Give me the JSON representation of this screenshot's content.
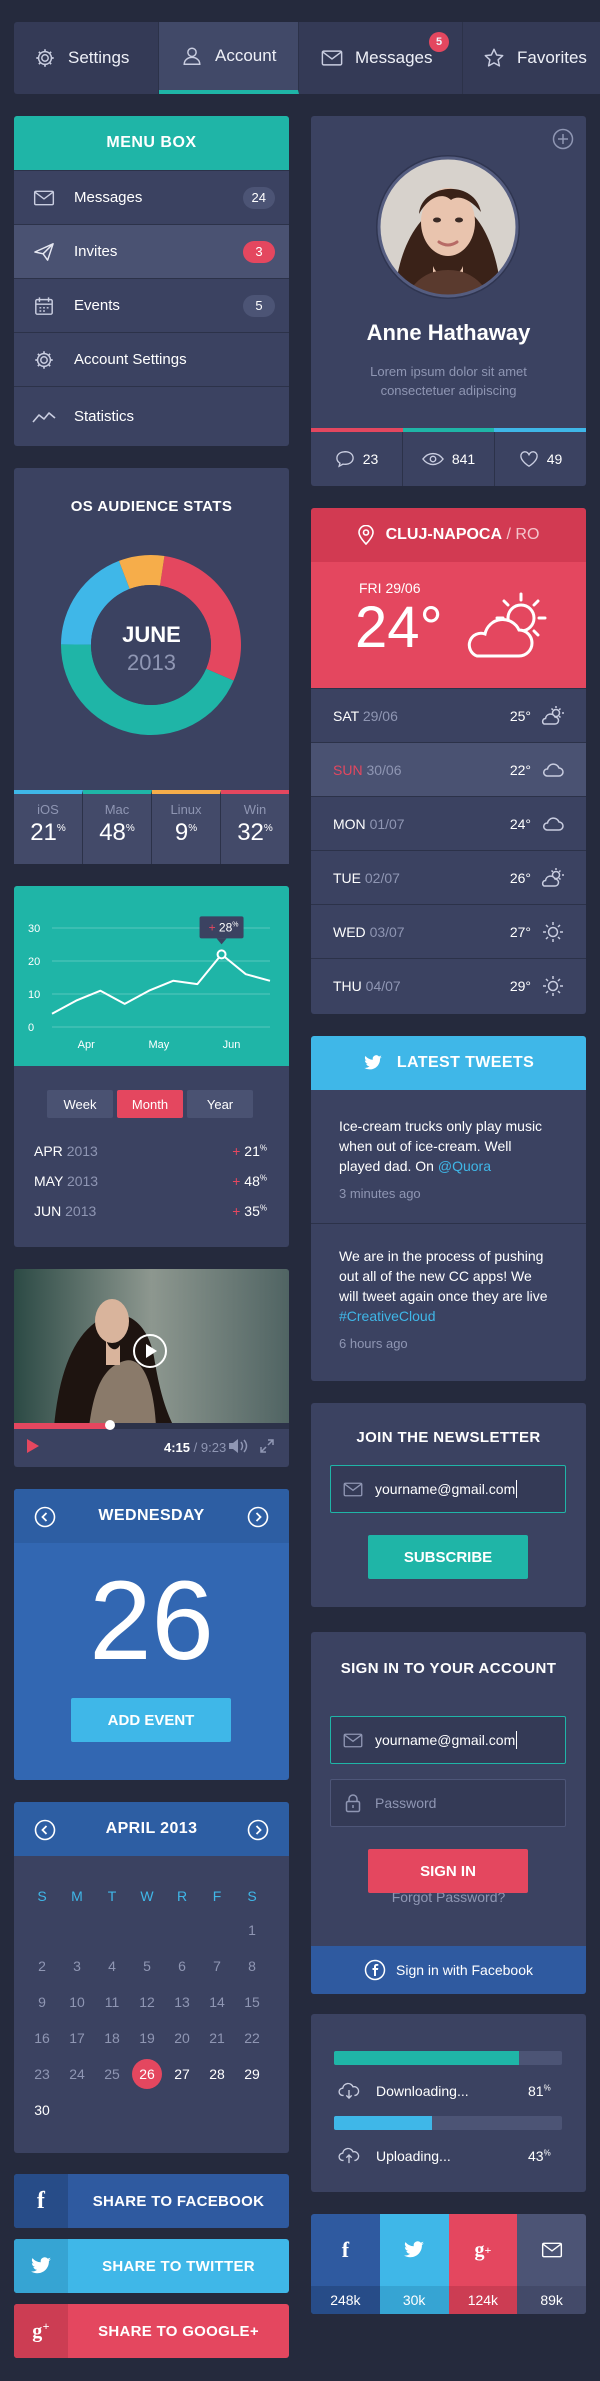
{
  "tabs": [
    {
      "label": "Settings",
      "icon": "gear-icon"
    },
    {
      "label": "Account",
      "icon": "user-icon",
      "active": true
    },
    {
      "label": "Messages",
      "icon": "envelope-icon",
      "badge": "5"
    },
    {
      "label": "Favorites",
      "icon": "star-icon"
    }
  ],
  "menu": {
    "title": "MENU BOX",
    "items": [
      {
        "label": "Messages",
        "icon": "envelope-icon",
        "count": "24"
      },
      {
        "label": "Invites",
        "icon": "send-icon",
        "count": "3"
      },
      {
        "label": "Events",
        "icon": "calendar-icon",
        "count": "5"
      },
      {
        "label": "Account Settings",
        "icon": "gear-icon"
      },
      {
        "label": "Statistics",
        "icon": "trend-icon"
      }
    ]
  },
  "profile": {
    "name": "Anne Hathaway",
    "bio_line1": "Lorem ipsum dolor sit amet",
    "bio_line2": "consectetuer adipiscing",
    "comments": "23",
    "views": "841",
    "likes": "49"
  },
  "os_stats": {
    "title": "OS AUDIENCE STATS",
    "month": "JUNE",
    "year": "2013",
    "items": [
      {
        "label": "iOS",
        "value": "21",
        "unit": "%",
        "color": "#3fb7e8"
      },
      {
        "label": "Mac",
        "value": "48",
        "unit": "%",
        "color": "#1fb5a7"
      },
      {
        "label": "Linux",
        "value": "9",
        "unit": "%",
        "color": "#f6ad4a"
      },
      {
        "label": "Win",
        "value": "32",
        "unit": "%",
        "color": "#e4475f"
      }
    ]
  },
  "chart_data": {
    "type": "line",
    "title": "",
    "xlabel": "",
    "ylabel": "",
    "ylim": [
      0,
      30
    ],
    "yticks": [
      0,
      10,
      20,
      30
    ],
    "categories": [
      "Apr",
      "May",
      "Jun"
    ],
    "x": [
      0,
      1,
      2,
      3,
      4,
      5,
      6,
      7,
      8,
      9
    ],
    "values": [
      4,
      8,
      11,
      7,
      11,
      14,
      13,
      22,
      16,
      14
    ],
    "highlight": {
      "index": 7,
      "label": "28",
      "unit": "%"
    },
    "grid": true
  },
  "chart_tabs": [
    "Week",
    "Month",
    "Year"
  ],
  "chart_tab_active": 1,
  "chart_rows": [
    {
      "month": "APR",
      "year": "2013",
      "delta": "21",
      "unit": "%"
    },
    {
      "month": "MAY",
      "year": "2013",
      "delta": "48",
      "unit": "%"
    },
    {
      "month": "JUN",
      "year": "2013",
      "delta": "35",
      "unit": "%"
    }
  ],
  "video": {
    "current": "4:15",
    "total": "/ 9:23",
    "progress": 0.35
  },
  "day_card": {
    "weekday": "WEDNESDAY",
    "day": "26",
    "button": "ADD EVENT"
  },
  "calendar": {
    "title": "APRIL 2013",
    "weekdays": [
      "S",
      "M",
      "T",
      "W",
      "R",
      "F",
      "S"
    ],
    "selected": "26"
  },
  "share": [
    {
      "label": "SHARE TO FACEBOOK",
      "icon": "facebook-icon",
      "color": "#2f5aa0",
      "sq": "#274c88"
    },
    {
      "label": "SHARE TO TWITTER",
      "icon": "twitter-icon",
      "color": "#3fb7e8",
      "sq": "#36a4d3"
    },
    {
      "label": "SHARE TO GOOGLE+",
      "icon": "googleplus-icon",
      "color": "#e4475f",
      "sq": "#cc3d53"
    }
  ],
  "weather": {
    "city": "CLUJ-NAPOCA",
    "country": "/ RO",
    "today_day": "FRI",
    "today_date": "29/06",
    "today_temp": "24°",
    "forecast": [
      {
        "day": "SAT",
        "date": "29/06",
        "temp": "25°",
        "icon": "sun-cloud-icon"
      },
      {
        "day": "SUN",
        "date": "30/06",
        "temp": "22°",
        "icon": "cloud-icon"
      },
      {
        "day": "MON",
        "date": "01/07",
        "temp": "24°",
        "icon": "cloud-icon"
      },
      {
        "day": "TUE",
        "date": "02/07",
        "temp": "26°",
        "icon": "sun-cloud-icon"
      },
      {
        "day": "WED",
        "date": "03/07",
        "temp": "27°",
        "icon": "sun-icon"
      },
      {
        "day": "THU",
        "date": "04/07",
        "temp": "29°",
        "icon": "sun-icon"
      }
    ]
  },
  "tweets": {
    "title": "LATEST TWEETS",
    "items": [
      {
        "lines": [
          "Ice-cream trucks only play music",
          "when out of ice-cream. Well",
          "played dad. On "
        ],
        "link": "@Quora",
        "time": "3 minutes ago"
      },
      {
        "lines": [
          "We are in the process of pushing",
          "out all of the new CC apps! We",
          "will tweet again once they are live"
        ],
        "link": "#CreativeCloud",
        "time": "6 hours ago"
      }
    ]
  },
  "newsletter": {
    "title": "JOIN THE NEWSLETTER",
    "email": "yourname@gmail.com",
    "button": "SUBSCRIBE"
  },
  "signin": {
    "title": "SIGN IN TO YOUR ACCOUNT",
    "email": "yourname@gmail.com",
    "password_placeholder": "Password",
    "button": "SIGN IN",
    "forgot": "Forgot Password?",
    "facebook": "Sign in with Facebook"
  },
  "transfers": [
    {
      "label": "Downloading...",
      "value": "81",
      "unit": "%",
      "progress": 0.81,
      "color": "#1fb5a7"
    },
    {
      "label": "Uploading...",
      "value": "43",
      "unit": "%",
      "progress": 0.43,
      "color": "#3fb7e8"
    }
  ],
  "social_counts": [
    {
      "icon": "facebook-icon",
      "count": "248k",
      "color": "#2f5aa0",
      "dark": "#274c88"
    },
    {
      "icon": "twitter-icon",
      "count": "30k",
      "color": "#3fb7e8",
      "dark": "#36a4d3"
    },
    {
      "icon": "googleplus-icon",
      "count": "124k",
      "color": "#e4475f",
      "dark": "#cc3d53"
    },
    {
      "icon": "envelope-icon",
      "count": "89k",
      "color": "#4c5475",
      "dark": "#434a69"
    }
  ]
}
